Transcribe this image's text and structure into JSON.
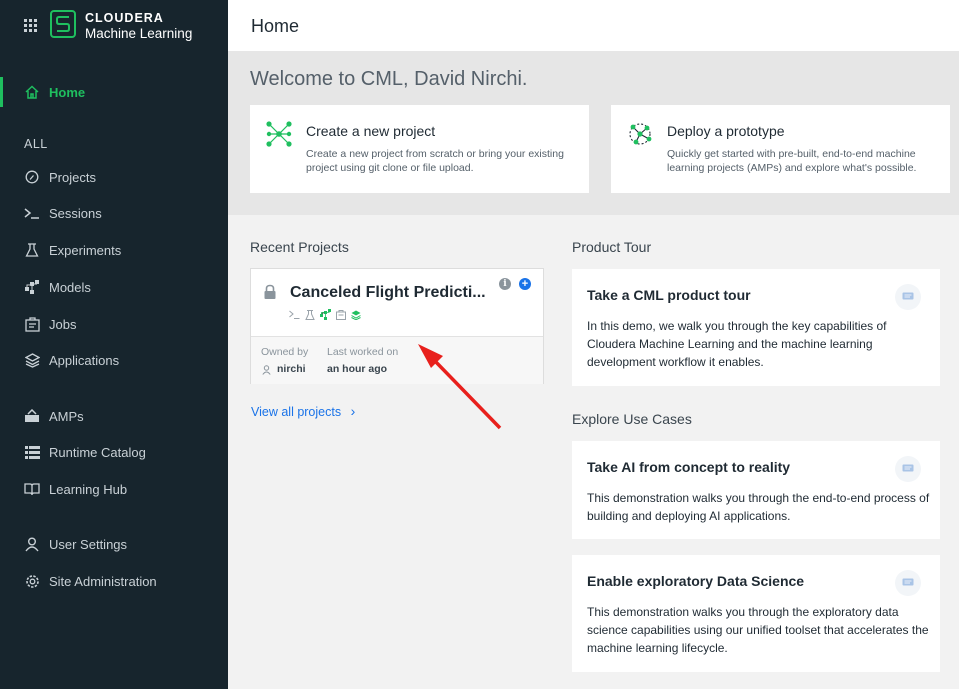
{
  "brand": {
    "name": "CLOUDERA",
    "product": "Machine Learning"
  },
  "sidebar": {
    "home_label": "Home",
    "section_label": "ALL",
    "items": [
      {
        "label": "Projects",
        "icon": "gauge-icon"
      },
      {
        "label": "Sessions",
        "icon": "terminal-icon"
      },
      {
        "label": "Experiments",
        "icon": "flask-icon"
      },
      {
        "label": "Models",
        "icon": "model-icon"
      },
      {
        "label": "Jobs",
        "icon": "jobs-icon"
      },
      {
        "label": "Applications",
        "icon": "layers-icon"
      },
      {
        "label": "AMPs",
        "icon": "amps-icon"
      },
      {
        "label": "Runtime Catalog",
        "icon": "list-icon"
      },
      {
        "label": "Learning Hub",
        "icon": "book-icon"
      },
      {
        "label": "User Settings",
        "icon": "user-icon"
      },
      {
        "label": "Site Administration",
        "icon": "gear-icon"
      }
    ]
  },
  "header": {
    "title": "Home"
  },
  "welcome": {
    "title": "Welcome to CML, David Nirchi.",
    "cards": [
      {
        "title": "Create a new project",
        "desc": "Create a new project from scratch or bring your existing project using git clone or file upload."
      },
      {
        "title": "Deploy a prototype",
        "desc": "Quickly get started with pre-built, end-to-end machine learning projects (AMPs) and explore what's possible."
      }
    ]
  },
  "recent": {
    "title": "Recent Projects",
    "project": {
      "name": "Canceled Flight Predicti...",
      "owned_by_label": "Owned by",
      "owner": "nirchi",
      "last_worked_label": "Last worked on",
      "last_worked": "an hour ago"
    },
    "view_all": "View all projects",
    "view_all_chevron": "›"
  },
  "product_tour": {
    "title": "Product Tour",
    "card": {
      "title": "Take a CML product tour",
      "desc": "In this demo, we walk you through the key capabilities of Cloudera Machine Learning and the machine learning development workflow it enables."
    }
  },
  "use_cases": {
    "title": "Explore Use Cases",
    "cards": [
      {
        "title": "Take AI from concept to reality",
        "desc": "This demonstration walks you through the end-to-end process of building and deploying AI applications."
      },
      {
        "title": "Enable exploratory Data Science",
        "desc": "This demonstration walks you through the exploratory data science capabilities using our unified toolset that accelerates the machine learning lifecycle."
      }
    ]
  },
  "colors": {
    "sidebar_bg": "#17252d",
    "accent": "#1fbf5f",
    "link": "#1a73e8",
    "arrow": "#e8201c"
  }
}
